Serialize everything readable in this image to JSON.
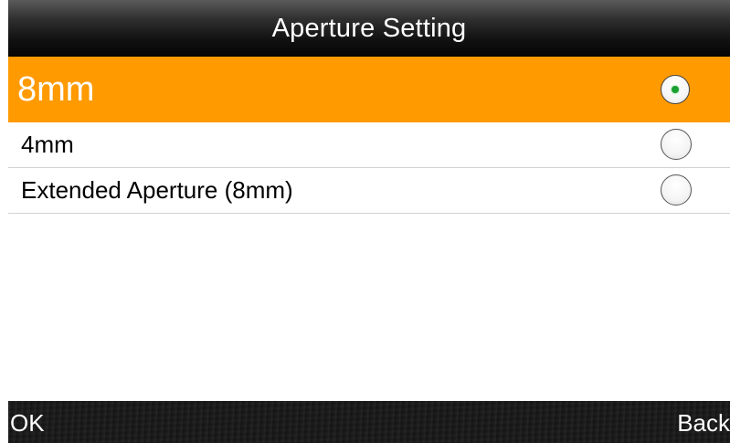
{
  "header": {
    "title": "Aperture Setting"
  },
  "options": [
    {
      "label": "8mm",
      "selected": true
    },
    {
      "label": "4mm",
      "selected": false
    },
    {
      "label": "Extended Aperture (8mm)",
      "selected": false
    }
  ],
  "softkeys": {
    "left_label": "OK",
    "right_label": "Back"
  },
  "colors": {
    "selection_highlight": "#ff9a00",
    "radio_selected_dot": "#1aa032",
    "title_bar": "#111111"
  },
  "icons": {
    "radio_selected": "radio-selected-icon",
    "radio_unselected": "radio-unselected-icon"
  }
}
